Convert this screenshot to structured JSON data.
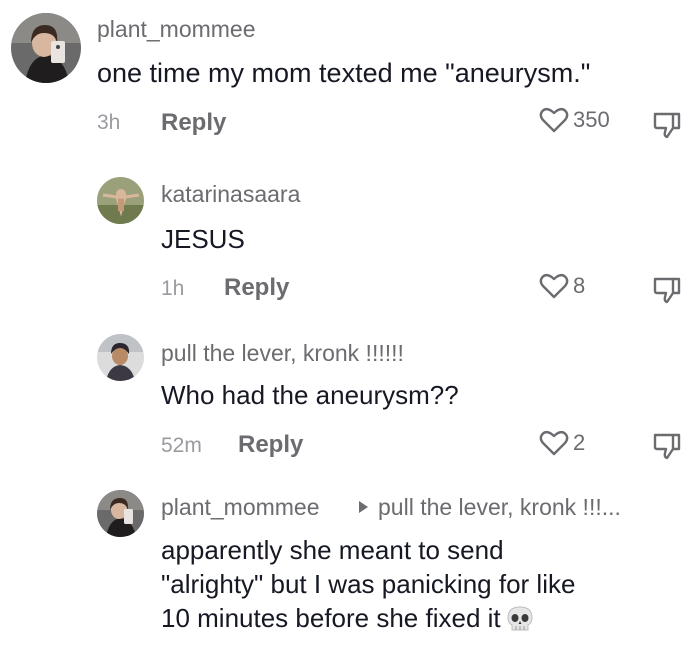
{
  "comments": [
    {
      "username": "plant_mommee",
      "text": "one time my mom texted me \"aneurysm.\"",
      "time": "3h",
      "reply_label": "Reply",
      "likes": "350"
    },
    {
      "username": "katarinasaara",
      "text": "JESUS",
      "time": "1h",
      "reply_label": "Reply",
      "likes": "8"
    },
    {
      "username": "pull the lever, kronk !!!!!!",
      "text": "Who had the aneurysm??",
      "time": "52m",
      "reply_label": "Reply",
      "likes": "2"
    },
    {
      "username": "plant_mommee",
      "reply_to": "pull the lever, kronk !!!...",
      "text_lines": [
        "apparently she meant to send",
        "\"alrighty\" but I was panicking for like",
        "10 minutes before she fixed it"
      ]
    }
  ],
  "icons": {
    "like": "heart-outline-icon",
    "dislike": "thumbs-down-icon",
    "emoji": "skull-emoji"
  },
  "colors": {
    "text": "#161823",
    "secondary": "#6b6b70",
    "time": "#9a9aa0"
  }
}
